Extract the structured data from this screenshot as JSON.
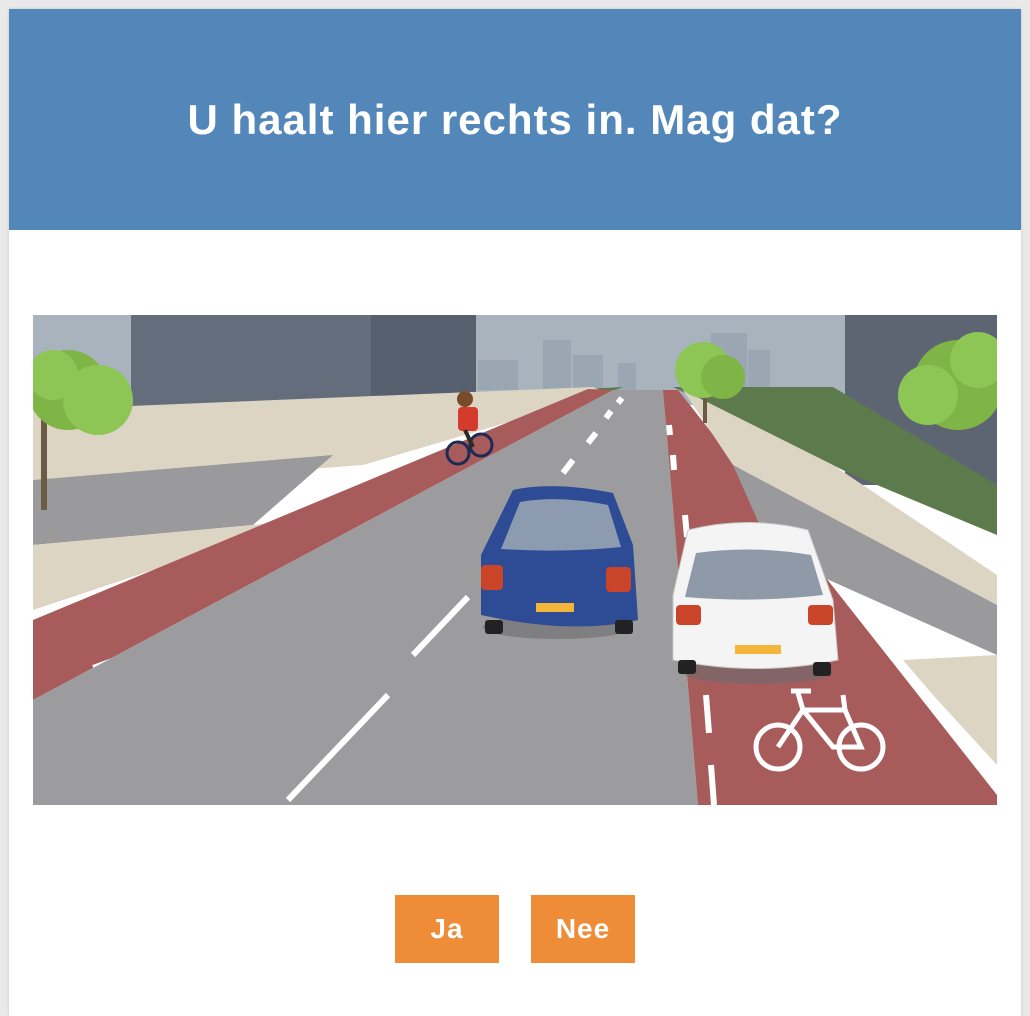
{
  "question": {
    "title": "U haalt hier rechts in. Mag dat?"
  },
  "answers": {
    "yes_label": "Ja",
    "no_label": "Nee"
  },
  "colors": {
    "header": "#5487b9",
    "button": "#ef8c38",
    "cycle_path": "#a85b5b",
    "road": "#9c9c9e"
  },
  "illustration": {
    "scene": "traffic-situation",
    "icons": [
      "bicycle-symbol-icon",
      "blue-car",
      "white-car",
      "cyclist",
      "tree"
    ]
  }
}
